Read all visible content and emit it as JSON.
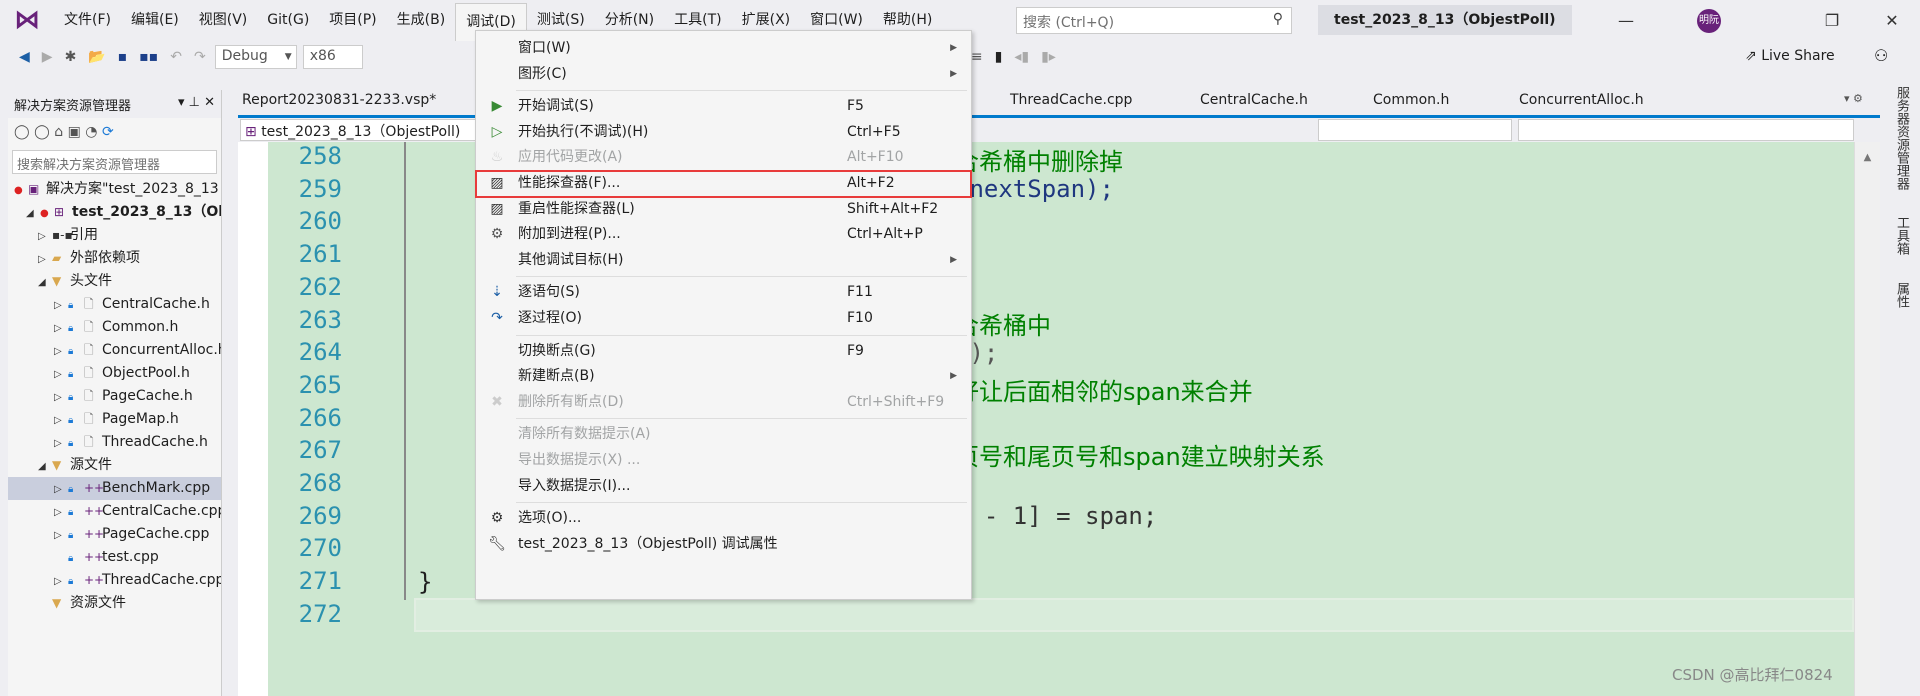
{
  "menubar": {
    "items": [
      "文件(F)",
      "编辑(E)",
      "视图(V)",
      "Git(G)",
      "项目(P)",
      "生成(B)",
      "调试(D)",
      "测试(S)",
      "分析(N)",
      "工具(T)",
      "扩展(X)",
      "窗口(W)",
      "帮助(H)"
    ],
    "search_placeholder": "搜索 (Ctrl+Q)",
    "solution_title": "test_2023_8_13（ObjestPoll)",
    "avatar": "明阮"
  },
  "toolbar": {
    "config": "Debug",
    "platform": "x86",
    "live_share": "Live Share"
  },
  "solution_explorer": {
    "title": "解决方案资源管理器",
    "search_placeholder": "搜索解决方案资源管理器",
    "items": [
      {
        "label": "解决方案\"test_2023_8_13",
        "level": 0,
        "icon": "solution-icon"
      },
      {
        "label": "test_2023_8_13（Ob",
        "level": 1,
        "icon": "project-icon",
        "expanded": true,
        "bold": true
      },
      {
        "label": "引用",
        "level": 2,
        "icon": "reference-icon"
      },
      {
        "label": "外部依赖项",
        "level": 2,
        "icon": "folder-icon"
      },
      {
        "label": "头文件",
        "level": 2,
        "icon": "filter-folder-icon",
        "expanded": true
      },
      {
        "label": "CentralCache.h",
        "level": 3,
        "icon": "header-file-icon"
      },
      {
        "label": "Common.h",
        "level": 3,
        "icon": "header-file-icon"
      },
      {
        "label": "ConcurrentAlloc.h",
        "level": 3,
        "icon": "header-file-icon"
      },
      {
        "label": "ObjectPool.h",
        "level": 3,
        "icon": "header-file-icon"
      },
      {
        "label": "PageCache.h",
        "level": 3,
        "icon": "header-file-icon"
      },
      {
        "label": "PageMap.h",
        "level": 3,
        "icon": "header-file-icon"
      },
      {
        "label": "ThreadCache.h",
        "level": 3,
        "icon": "header-file-icon"
      },
      {
        "label": "源文件",
        "level": 2,
        "icon": "filter-folder-icon",
        "expanded": true
      },
      {
        "label": "BenchMark.cpp",
        "level": 3,
        "icon": "cpp-file-icon",
        "selected": true
      },
      {
        "label": "CentralCache.cpp",
        "level": 3,
        "icon": "cpp-file-icon"
      },
      {
        "label": "PageCache.cpp",
        "level": 3,
        "icon": "cpp-file-icon"
      },
      {
        "label": "test.cpp",
        "level": 3,
        "icon": "cpp-file-icon",
        "noarrow": true
      },
      {
        "label": "ThreadCache.cpp",
        "level": 3,
        "icon": "cpp-file-icon"
      },
      {
        "label": "资源文件",
        "level": 2,
        "icon": "filter-folder-icon",
        "noarrow": true
      }
    ]
  },
  "editor": {
    "tabs": [
      "Report20230831-2233.vsp*",
      "ThreadCache.cpp",
      "CentralCache.h",
      "Common.h",
      "ConcurrentAlloc.h"
    ],
    "project_dropdown": "test_2023_8_13（ObjestPoll)",
    "line_numbers": [
      "258",
      "259",
      "260",
      "261",
      "262",
      "263",
      "264",
      "265",
      "266",
      "267",
      "268",
      "269",
      "270",
      "271",
      "272"
    ],
    "code": {
      "l258": "合希桶中删除掉",
      "l259": "(nextSpan);",
      "l263": "合希桶中",
      "l264": "n);",
      "l265": "好让后面相邻的span来合并",
      "l267": "页号和尾页号和span建立映射关系",
      "l269": "n - 1] = span;",
      "l271": "}"
    }
  },
  "debug_menu": {
    "items": [
      {
        "label": "窗口(W)",
        "submenu": true
      },
      {
        "label": "图形(C)",
        "submenu": true,
        "sep_after": true
      },
      {
        "label": "开始调试(S)",
        "key": "F5",
        "icon": "play-icon"
      },
      {
        "label": "开始执行(不调试)(H)",
        "key": "Ctrl+F5",
        "icon": "play-outline-icon"
      },
      {
        "label": "应用代码更改(A)",
        "key": "Alt+F10",
        "icon": "flame-icon",
        "disabled": true
      },
      {
        "label": "性能探查器(F)...",
        "key": "Alt+F2",
        "icon": "performance-icon",
        "highlighted": true
      },
      {
        "label": "重启性能探查器(L)",
        "key": "Shift+Alt+F2",
        "icon": "performance-restart-icon"
      },
      {
        "label": "附加到进程(P)...",
        "key": "Ctrl+Alt+P",
        "icon": "gears-icon"
      },
      {
        "label": "其他调试目标(H)",
        "submenu": true,
        "sep_after": true
      },
      {
        "label": "逐语句(S)",
        "key": "F11",
        "icon": "step-into-icon"
      },
      {
        "label": "逐过程(O)",
        "key": "F10",
        "icon": "step-over-icon",
        "sep_after": true
      },
      {
        "label": "切换断点(G)",
        "key": "F9"
      },
      {
        "label": "新建断点(B)",
        "submenu": true
      },
      {
        "label": "删除所有断点(D)",
        "key": "Ctrl+Shift+F9",
        "icon": "delete-breakpoints-icon",
        "disabled": true,
        "sep_after": true
      },
      {
        "label": "清除所有数据提示(A)",
        "disabled": true
      },
      {
        "label": "导出数据提示(X) ...",
        "disabled": true
      },
      {
        "label": "导入数据提示(I)...",
        "sep_after": true
      },
      {
        "label": "选项(O)...",
        "icon": "gear-icon"
      },
      {
        "label": "test_2023_8_13（ObjestPoll)  调试属性",
        "icon": "wrench-icon"
      }
    ]
  },
  "right_strip": [
    "服务器资源管理器",
    "工具箱",
    "属性"
  ],
  "watermark": "CSDN @高比拜仁0824",
  "colors": {
    "accent": "#007acc",
    "highlight_box": "#e83b3b",
    "editor_bg": "#cde7d0",
    "comment": "#008000",
    "line_number": "#2b91af"
  }
}
